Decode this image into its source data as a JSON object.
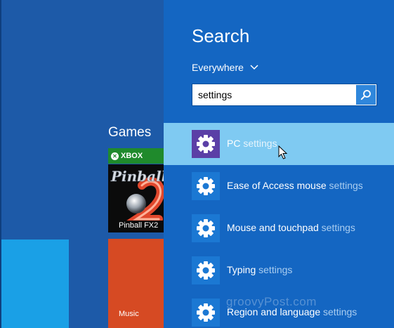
{
  "start_screen": {
    "group_label": "Games",
    "xbox_badge": "XBOX",
    "tiles": [
      {
        "name": "pinball",
        "label": "Pinball FX2"
      },
      {
        "name": "music",
        "label": "Music"
      }
    ],
    "pinball_logo_text": "Pinball"
  },
  "search_pane": {
    "title": "Search",
    "scope": "Everywhere",
    "query": "settings",
    "results": [
      {
        "prefix": "PC ",
        "match": "settings",
        "selected": true
      },
      {
        "prefix": "Ease of Access mouse ",
        "match": "settings",
        "selected": false
      },
      {
        "prefix": "Mouse and touchpad ",
        "match": "settings",
        "selected": false
      },
      {
        "prefix": "Typing ",
        "match": "settings",
        "selected": false
      },
      {
        "prefix": "Region and language ",
        "match": "settings",
        "selected": false
      }
    ]
  },
  "watermark": "groovyPost.com",
  "icons": {
    "scope_toggle": "chevron-down-icon",
    "search_button": "magnifier-icon",
    "result_icon": "gear-icon",
    "pointer": "mouse-cursor-icon"
  },
  "colors": {
    "start_background": "#1d5aa8",
    "pane_background": "#1466c2",
    "selected_row": "#7fcaf2",
    "selected_icon_tile": "#5b3fa6",
    "icon_tile": "#1b78d3",
    "xbox_green": "#1f8a2c",
    "music_tile": "#d64a23",
    "cyan_tile": "#1aa0e6"
  }
}
